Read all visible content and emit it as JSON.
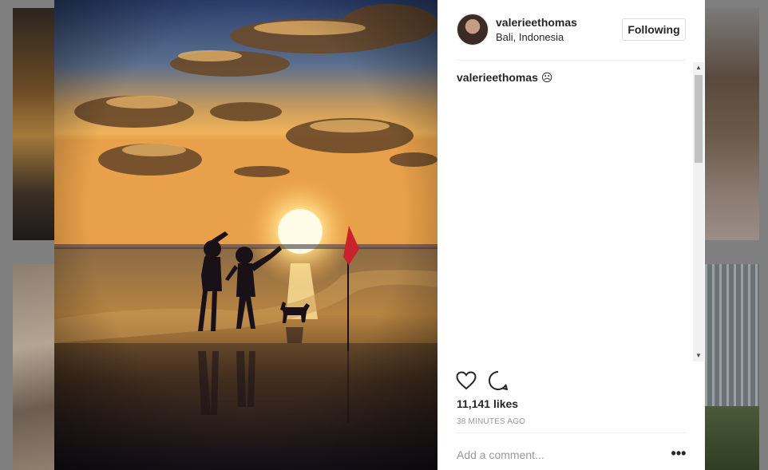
{
  "post": {
    "username": "valerieethomas",
    "location": "Bali, Indonesia",
    "follow_label": "Following",
    "caption_user": "valerieethomas",
    "caption_text": "☹",
    "likes": "11,141 likes",
    "time": "38 MINUTES AGO",
    "comment_placeholder": "Add a comment...",
    "more_label": "•••"
  },
  "icons": {
    "like": "heart-icon",
    "comment": "comment-icon",
    "more": "more-options-icon"
  },
  "colors": {
    "text": "#262626",
    "muted": "#999999",
    "border": "#dbdbdb"
  }
}
